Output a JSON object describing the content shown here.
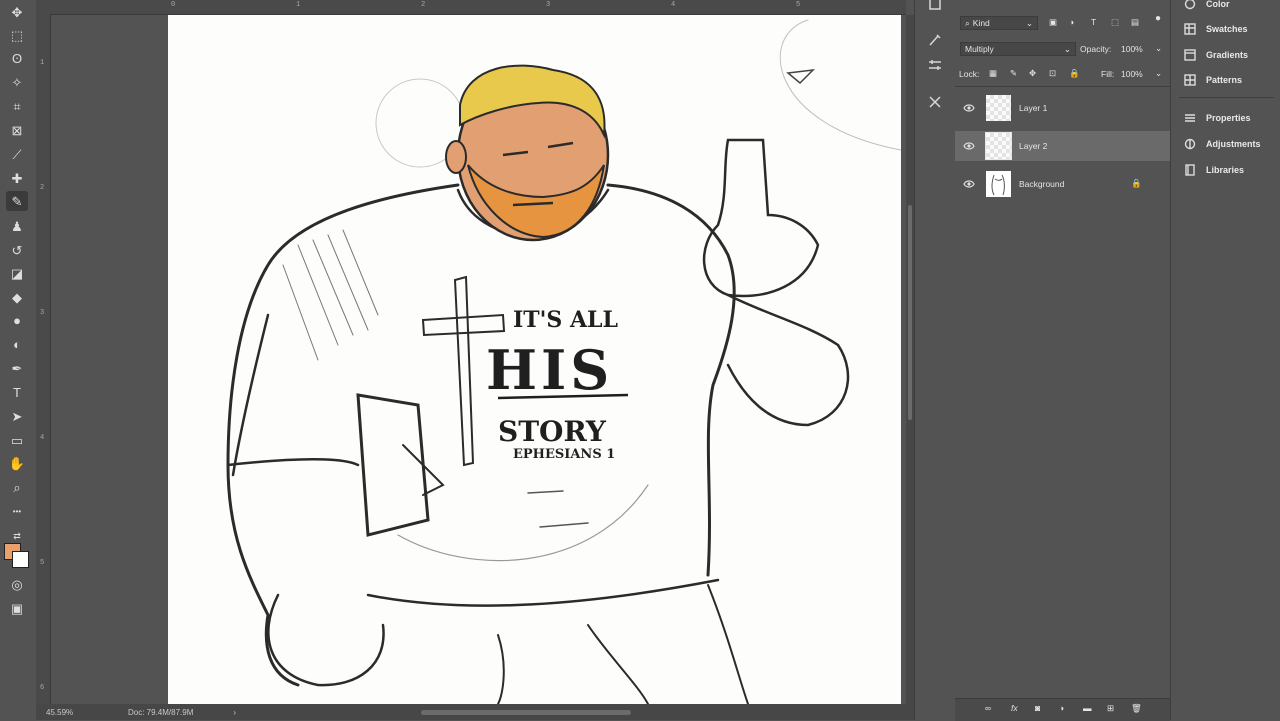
{
  "colors": {
    "foreground": "#e8a06c",
    "background": "#ffffff",
    "skin": "#e2a072",
    "beard": "#e79440",
    "hair": "#e8c94c",
    "panel": "#535353",
    "selected_row": "#6a6a6a"
  },
  "toolbar": {
    "tools": [
      {
        "name": "move-tool",
        "glyph": "✥"
      },
      {
        "name": "marquee-tool",
        "glyph": "⬚"
      },
      {
        "name": "lasso-tool",
        "glyph": "ʘ"
      },
      {
        "name": "magic-wand-tool",
        "glyph": "✧"
      },
      {
        "name": "crop-tool",
        "glyph": "⌗"
      },
      {
        "name": "frame-tool",
        "glyph": "⊠"
      },
      {
        "name": "eyedropper-tool",
        "glyph": "⟋"
      },
      {
        "name": "healing-brush-tool",
        "glyph": "✚"
      },
      {
        "name": "brush-tool",
        "glyph": "✎"
      },
      {
        "name": "clone-stamp-tool",
        "glyph": "♟"
      },
      {
        "name": "history-brush-tool",
        "glyph": "↺"
      },
      {
        "name": "eraser-tool",
        "glyph": "◪"
      },
      {
        "name": "paint-bucket-tool",
        "glyph": "◆"
      },
      {
        "name": "blur-tool",
        "glyph": "●"
      },
      {
        "name": "dodge-tool",
        "glyph": "◐"
      },
      {
        "name": "pen-tool",
        "glyph": "✒"
      },
      {
        "name": "type-tool",
        "glyph": "T"
      },
      {
        "name": "path-selection-tool",
        "glyph": "➤"
      },
      {
        "name": "rectangle-tool",
        "glyph": "▭"
      },
      {
        "name": "hand-tool",
        "glyph": "✋"
      },
      {
        "name": "zoom-tool",
        "glyph": "⌕"
      },
      {
        "name": "more-tools",
        "glyph": "•••"
      }
    ]
  },
  "ruler": {
    "top": [
      "0",
      "1",
      "2",
      "3",
      "4",
      "5"
    ],
    "left": [
      "1",
      "2",
      "3",
      "4",
      "5",
      "6"
    ]
  },
  "status": {
    "zoom": "45.59%",
    "doc": "Doc: 79.4M/87.9M",
    "arrow": "›"
  },
  "layers_panel": {
    "filter_label": "Kind",
    "blend_mode": "Multiply",
    "opacity_label": "Opacity:",
    "opacity_value": "100%",
    "lock_label": "Lock:",
    "fill_label": "Fill:",
    "fill_value": "100%",
    "layers": [
      {
        "name": "Layer 1",
        "visible": true,
        "selected": false,
        "locked": false
      },
      {
        "name": "Layer 2",
        "visible": true,
        "selected": true,
        "locked": false
      },
      {
        "name": "Background",
        "visible": true,
        "selected": false,
        "locked": true
      }
    ]
  },
  "side_panels": [
    {
      "label": "Color",
      "icon": "color-icon"
    },
    {
      "label": "Swatches",
      "icon": "swatches-icon"
    },
    {
      "label": "Gradients",
      "icon": "gradients-icon"
    },
    {
      "label": "Patterns",
      "icon": "patterns-icon"
    },
    {
      "label": "Properties",
      "icon": "properties-icon"
    },
    {
      "label": "Adjustments",
      "icon": "adjustments-icon"
    },
    {
      "label": "Libraries",
      "icon": "libraries-icon"
    }
  ],
  "artwork": {
    "shirt_line1": "IT'S ALL",
    "shirt_line2": "HIS",
    "shirt_line3": "STORY",
    "shirt_line4": "EPHESIANS 1"
  }
}
